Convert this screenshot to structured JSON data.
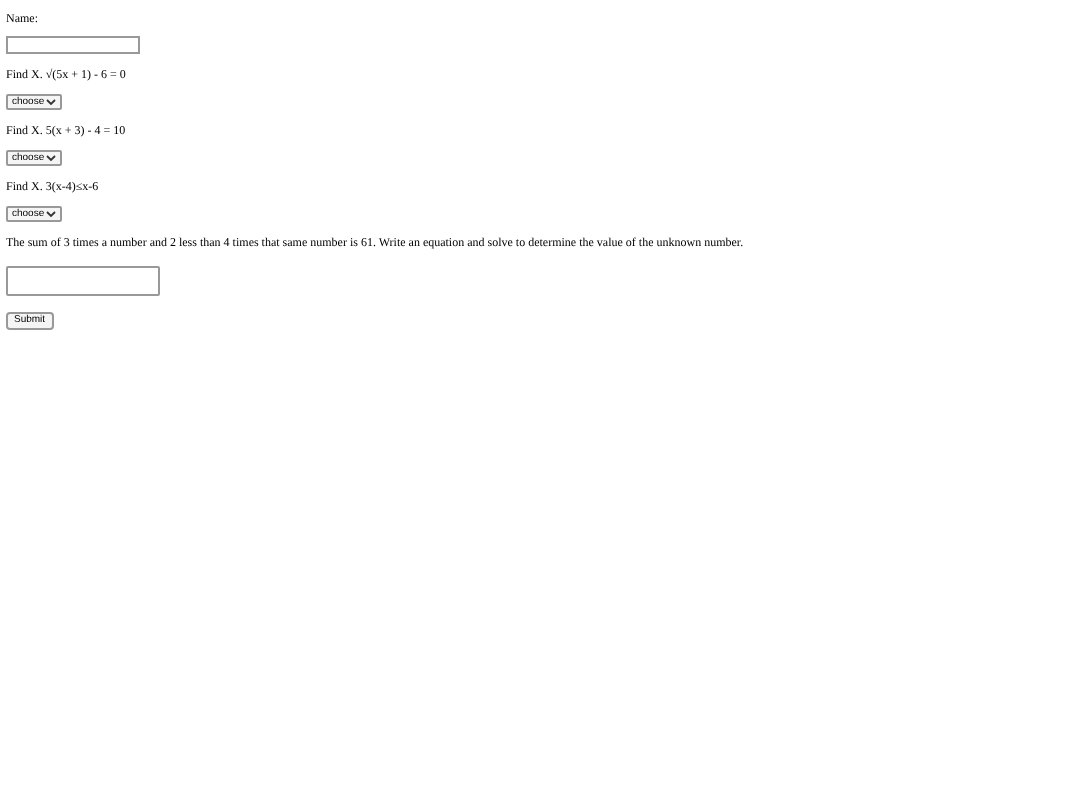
{
  "name_label": "Name:",
  "questions": [
    {
      "kind": "select",
      "prompt": "Find X. √(5x + 1) - 6 = 0",
      "value": "choose"
    },
    {
      "kind": "select",
      "prompt": "Find X. 5(x + 3) - 4 = 10",
      "value": "choose"
    },
    {
      "kind": "select",
      "prompt": "Find X. 3(x-4)≤x-6",
      "value": "choose"
    },
    {
      "kind": "text",
      "prompt": "The sum of 3 times a number and 2 less than 4 times that same number is 61. Write an equation and solve to determine the value of the unknown number."
    }
  ],
  "submit": "Submit"
}
